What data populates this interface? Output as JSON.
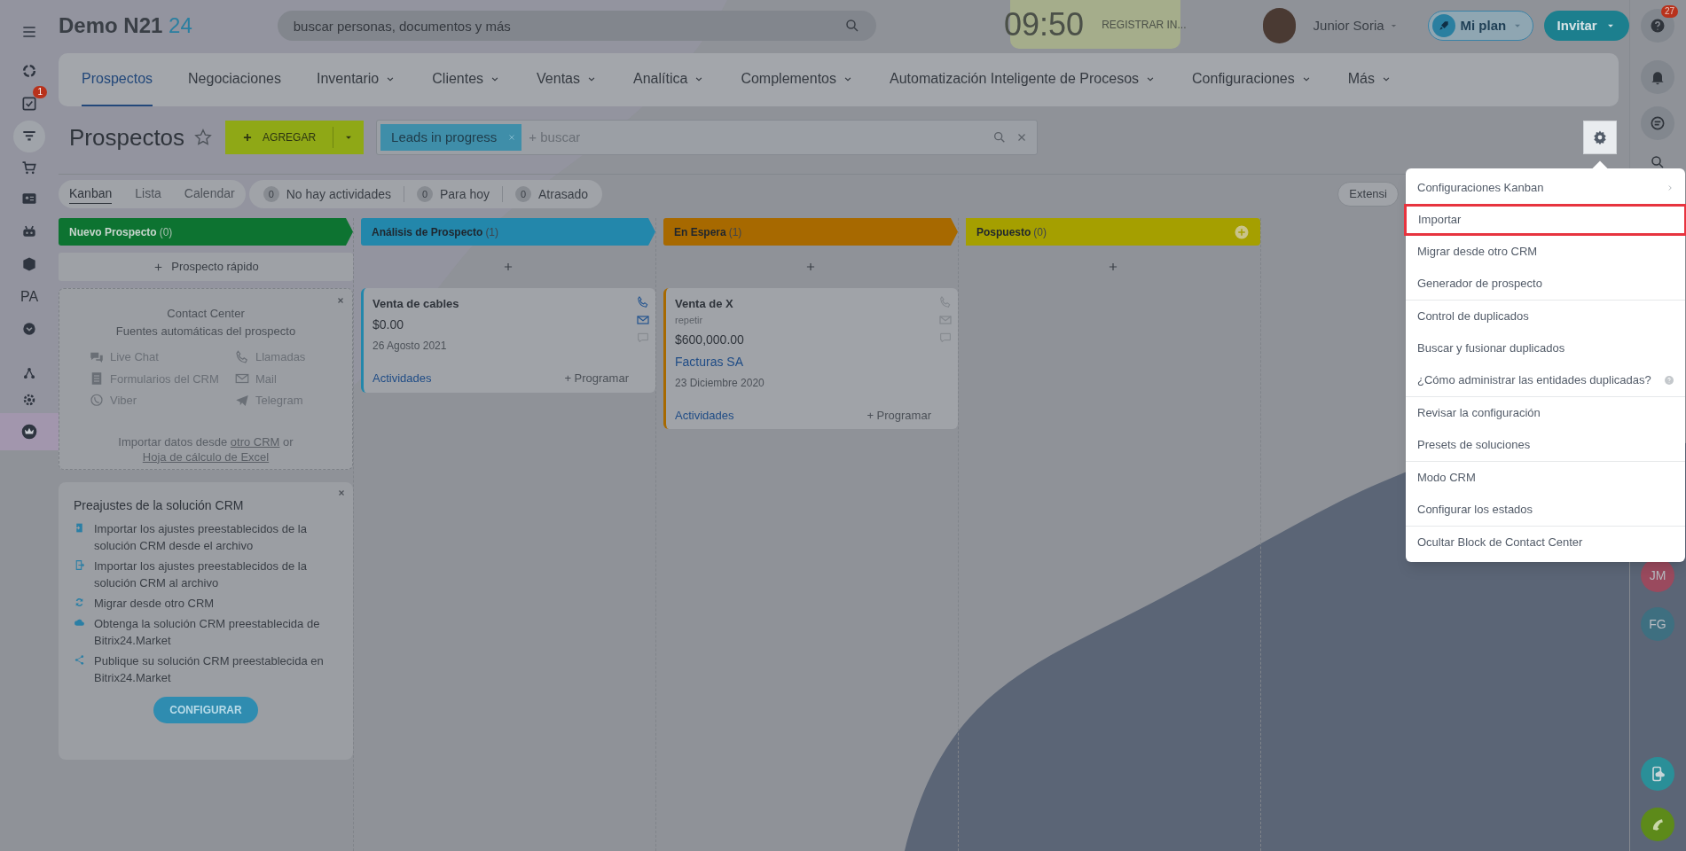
{
  "top_bar": {
    "logo": "Demo N21",
    "logo_accent": "24",
    "search_placeholder": "buscar personas, documentos y más",
    "clock": "09:50",
    "clock_action": "REGISTRAR IN...",
    "user_name": "Junior Soria",
    "plan_button": "Mi plan",
    "invite_button": "Invitar"
  },
  "left_sidebar": [
    {
      "kind": "icon",
      "selected": false
    },
    {
      "kind": "icon",
      "selected": false
    },
    {
      "kind": "icon",
      "selected": false,
      "badge": "1"
    },
    {
      "kind": "icon",
      "selected": true
    },
    {
      "kind": "icon",
      "selected": false
    },
    {
      "kind": "icon",
      "selected": false
    },
    {
      "kind": "icon",
      "selected": false
    },
    {
      "kind": "icon",
      "selected": false
    },
    {
      "kind": "text",
      "label": "PA",
      "selected": false
    },
    {
      "kind": "icon",
      "selected": false
    },
    {
      "kind": "icon",
      "selected": false
    },
    {
      "kind": "icon",
      "selected": false
    },
    {
      "kind": "icon",
      "selected": true
    }
  ],
  "nav_tabs": [
    {
      "label": "Prospectos",
      "selected": true,
      "dropdown": false
    },
    {
      "label": "Negociaciones",
      "selected": false,
      "dropdown": false
    },
    {
      "label": "Inventario",
      "selected": false,
      "dropdown": true
    },
    {
      "label": "Clientes",
      "selected": false,
      "dropdown": true
    },
    {
      "label": "Ventas",
      "selected": false,
      "dropdown": true
    },
    {
      "label": "Analítica",
      "selected": false,
      "dropdown": true
    },
    {
      "label": "Complementos",
      "selected": false,
      "dropdown": true
    },
    {
      "label": "Automatización Inteligente de Procesos",
      "selected": false,
      "dropdown": true
    },
    {
      "label": "Configuraciones",
      "selected": false,
      "dropdown": true
    },
    {
      "label": "Más",
      "selected": false,
      "dropdown": true
    }
  ],
  "page_title": "Prospectos",
  "add_button": "AGREGAR",
  "filter": {
    "tag": "Leads in progress",
    "placeholder": "+ buscar"
  },
  "view_tabs": [
    {
      "label": "Kanban",
      "selected": true
    },
    {
      "label": "Lista",
      "selected": false
    },
    {
      "label": "Calendar",
      "selected": false
    }
  ],
  "counters": [
    {
      "count": "0",
      "label": "No hay actividades"
    },
    {
      "count": "0",
      "label": "Para hoy"
    },
    {
      "count": "0",
      "label": "Atrasado"
    }
  ],
  "extension_button": "Extensi",
  "columns": [
    {
      "title": "Nuevo Prospecto",
      "count": "(0)",
      "color": "#0d7331",
      "quick_add": "Prospecto rápido",
      "add_icon": false
    },
    {
      "title": "Análisis de Prospecto",
      "count": "(1)",
      "color": "#2387ab",
      "add_icon": false,
      "cards": [
        {
          "title": "Venta de cables",
          "amount": "$0.00",
          "date": "26 Agosto 2021",
          "activities": "Actividades",
          "schedule": "+ Programar",
          "contacts_active": true
        }
      ]
    },
    {
      "title": "En Espera",
      "count": "(1)",
      "color": "#a76900",
      "add_icon": false,
      "cards": [
        {
          "title": "Venta de X",
          "subtitle": "repetir",
          "amount": "$600,000.00",
          "company": "Facturas SA",
          "date": "23 Diciembre 2020",
          "activities": "Actividades",
          "schedule": "+ Programar",
          "contacts_active": false
        }
      ]
    },
    {
      "title": "Pospuesto",
      "count": "(0)",
      "color": "#a59f00",
      "add_icon": true
    }
  ],
  "contact_center": {
    "title": "Contact Center",
    "subtitle": "Fuentes automáticas del prospecto",
    "channels": [
      "Live Chat",
      "Llamadas",
      "Formularios del CRM",
      "Mail",
      "Viber",
      "Telegram"
    ],
    "import_text": "Importar datos desde",
    "link_crm": "otro CRM",
    "conjunction": "or",
    "link_excel": "Hoja de cálculo de Excel"
  },
  "presets": {
    "title": "Preajustes de la solución CRM",
    "items": [
      "Importar los ajustes preestablecidos de la solución CRM desde el archivo",
      "Importar los ajustes preestablecidos de la solución CRM al archivo",
      "Migrar desde otro CRM",
      "Obtenga la solución CRM preestablecida de Bitrix24.Market",
      "Publique su solución CRM preestablecida en Bitrix24.Market"
    ],
    "button": "CONFIGURAR"
  },
  "settings_menu": [
    [
      {
        "label": "Configuraciones Kanban",
        "submenu": true,
        "help": false,
        "highlighted": false
      },
      {
        "label": "Importar",
        "submenu": false,
        "help": false,
        "highlighted": true
      },
      {
        "label": "Migrar desde otro CRM",
        "submenu": false,
        "help": false,
        "highlighted": false
      },
      {
        "label": "Generador de prospecto",
        "submenu": false,
        "help": false,
        "highlighted": false
      }
    ],
    [
      {
        "label": "Control de duplicados",
        "submenu": false,
        "help": false,
        "highlighted": false
      },
      {
        "label": "Buscar y fusionar duplicados",
        "submenu": false,
        "help": false,
        "highlighted": false
      },
      {
        "label": "¿Cómo administrar las entidades duplicadas?",
        "submenu": false,
        "help": true,
        "highlighted": false
      }
    ],
    [
      {
        "label": "Revisar la configuración",
        "submenu": false,
        "help": false,
        "highlighted": false
      },
      {
        "label": "Presets de soluciones",
        "submenu": false,
        "help": false,
        "highlighted": false
      }
    ],
    [
      {
        "label": "Modo CRM",
        "submenu": false,
        "help": false,
        "highlighted": false
      },
      {
        "label": "Configurar los estados",
        "submenu": false,
        "help": false,
        "highlighted": false
      }
    ],
    [
      {
        "label": "Ocultar Block de Contact Center",
        "submenu": false,
        "help": false,
        "highlighted": false
      }
    ]
  ],
  "right_sidebar": {
    "help_badge": "27",
    "avatars": [
      {
        "initials": "JM",
        "color": "#9a4a5e"
      },
      {
        "initials": "FG",
        "color": "#3e6f80"
      }
    ]
  }
}
